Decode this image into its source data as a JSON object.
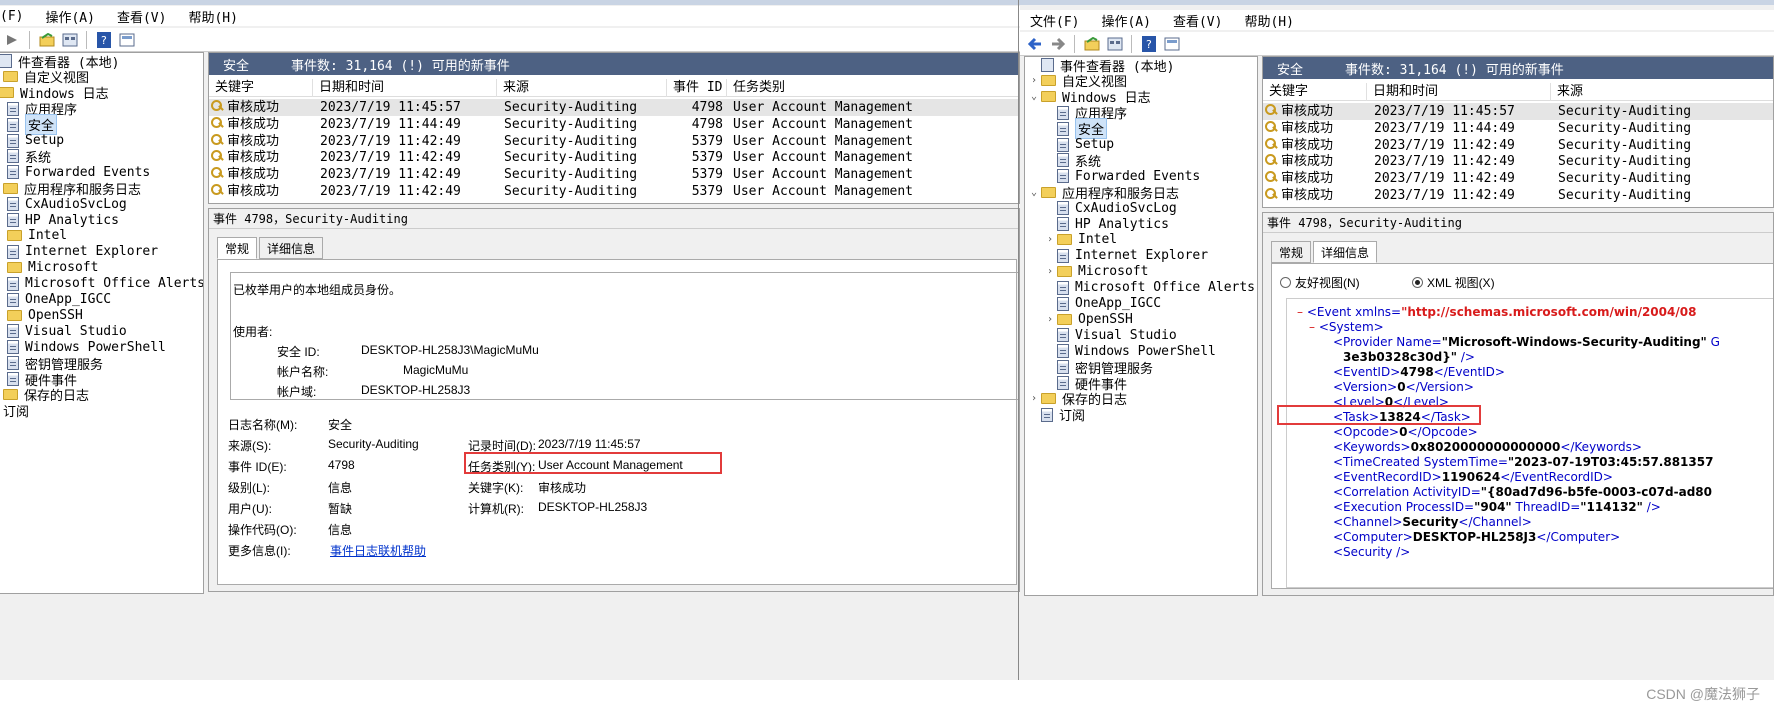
{
  "left": {
    "menu": [
      "(F)",
      "操作(A)",
      "查看(V)",
      "帮助(H)"
    ],
    "tree": [
      {
        "label": "件查看器 (本地)",
        "icon": "root",
        "selected": false
      },
      {
        "label": "自定义视图",
        "icon": "folder",
        "selected": false
      },
      {
        "label": "Windows 日志",
        "icon": "folder",
        "selected": false
      },
      {
        "label": "应用程序",
        "icon": "log",
        "selected": false
      },
      {
        "label": "安全",
        "icon": "log",
        "selected": true
      },
      {
        "label": "Setup",
        "icon": "log",
        "selected": false
      },
      {
        "label": "系统",
        "icon": "log",
        "selected": false
      },
      {
        "label": "Forwarded Events",
        "icon": "log",
        "selected": false
      },
      {
        "label": "应用程序和服务日志",
        "icon": "folder",
        "selected": false
      },
      {
        "label": "CxAudioSvcLog",
        "icon": "log",
        "selected": false
      },
      {
        "label": "HP Analytics",
        "icon": "log",
        "selected": false
      },
      {
        "label": "Intel",
        "icon": "folder",
        "selected": false
      },
      {
        "label": "Internet Explorer",
        "icon": "log",
        "selected": false
      },
      {
        "label": "Microsoft",
        "icon": "folder",
        "selected": false
      },
      {
        "label": "Microsoft Office Alerts",
        "icon": "log",
        "selected": false
      },
      {
        "label": "OneApp_IGCC",
        "icon": "log",
        "selected": false
      },
      {
        "label": "OpenSSH",
        "icon": "folder",
        "selected": false
      },
      {
        "label": "Visual Studio",
        "icon": "log",
        "selected": false
      },
      {
        "label": "Windows PowerShell",
        "icon": "log",
        "selected": false
      },
      {
        "label": "密钥管理服务",
        "icon": "log",
        "selected": false
      },
      {
        "label": "硬件事件",
        "icon": "log",
        "selected": false
      },
      {
        "label": "保存的日志",
        "icon": "folder",
        "selected": false
      },
      {
        "label": "订阅",
        "icon": "none",
        "selected": false
      }
    ],
    "header": {
      "name": "安全",
      "count": "事件数: 31,164 (!) 可用的新事件"
    },
    "columns": [
      "关键字",
      "日期和时间",
      "来源",
      "事件 ID",
      "任务类别"
    ],
    "rows": [
      [
        "审核成功",
        "2023/7/19 11:45:57",
        "Security-Auditing",
        "4798",
        "User Account Management"
      ],
      [
        "审核成功",
        "2023/7/19 11:44:49",
        "Security-Auditing",
        "4798",
        "User Account Management"
      ],
      [
        "审核成功",
        "2023/7/19 11:42:49",
        "Security-Auditing",
        "5379",
        "User Account Management"
      ],
      [
        "审核成功",
        "2023/7/19 11:42:49",
        "Security-Auditing",
        "5379",
        "User Account Management"
      ],
      [
        "审核成功",
        "2023/7/19 11:42:49",
        "Security-Auditing",
        "5379",
        "User Account Management"
      ],
      [
        "审核成功",
        "2023/7/19 11:42:49",
        "Security-Auditing",
        "5379",
        "User Account Management"
      ]
    ],
    "detail": {
      "title": "事件 4798，Security-Auditing",
      "tabs": [
        "常规",
        "详细信息"
      ],
      "description": "已枚举用户的本地组成员身份。",
      "user_label": "使用者:",
      "sid_label": "安全 ID:",
      "sid_value": "DESKTOP-HL258J3\\MagicMuMu",
      "acct_label": "帐户名称:",
      "acct_value": "MagicMuMu",
      "domain_label": "帐户域:",
      "domain_value": "DESKTOP-HL258J3",
      "log_name_label": "日志名称(M):",
      "log_name": "安全",
      "source_label": "来源(S):",
      "source": "Security-Auditing",
      "logged_label": "记录时间(D):",
      "logged": "2023/7/19 11:45:57",
      "event_id_label": "事件 ID(E):",
      "event_id": "4798",
      "task_label": "任务类别(Y):",
      "task": "User Account Management",
      "level_label": "级别(L):",
      "level": "信息",
      "keywords_label": "关键字(K):",
      "keywords": "审核成功",
      "user2_label": "用户(U):",
      "user2": "暂缺",
      "computer_label": "计算机(R):",
      "computer": "DESKTOP-HL258J3",
      "opcode_label": "操作代码(O):",
      "opcode": "信息",
      "more_label": "更多信息(I):",
      "more_link": "事件日志联机帮助"
    }
  },
  "right": {
    "menu": [
      "文件(F)",
      "操作(A)",
      "查看(V)",
      "帮助(H)"
    ],
    "tree": [
      {
        "label": "事件查看器 (本地)",
        "icon": "root",
        "arrow": ""
      },
      {
        "label": "自定义视图",
        "icon": "folder",
        "arrow": "›"
      },
      {
        "label": "Windows 日志",
        "icon": "folder",
        "arrow": "⌄"
      },
      {
        "label": "应用程序",
        "icon": "log",
        "arrow": ""
      },
      {
        "label": "安全",
        "icon": "log",
        "arrow": "",
        "selected": true
      },
      {
        "label": "Setup",
        "icon": "log",
        "arrow": ""
      },
      {
        "label": "系统",
        "icon": "log",
        "arrow": ""
      },
      {
        "label": "Forwarded Events",
        "icon": "log",
        "arrow": ""
      },
      {
        "label": "应用程序和服务日志",
        "icon": "folder",
        "arrow": "⌄"
      },
      {
        "label": "CxAudioSvcLog",
        "icon": "log",
        "arrow": ""
      },
      {
        "label": "HP Analytics",
        "icon": "log",
        "arrow": ""
      },
      {
        "label": "Intel",
        "icon": "folder",
        "arrow": "›"
      },
      {
        "label": "Internet Explorer",
        "icon": "log",
        "arrow": ""
      },
      {
        "label": "Microsoft",
        "icon": "folder",
        "arrow": "›"
      },
      {
        "label": "Microsoft Office Alerts",
        "icon": "log",
        "arrow": ""
      },
      {
        "label": "OneApp_IGCC",
        "icon": "log",
        "arrow": ""
      },
      {
        "label": "OpenSSH",
        "icon": "folder",
        "arrow": "›"
      },
      {
        "label": "Visual Studio",
        "icon": "log",
        "arrow": ""
      },
      {
        "label": "Windows PowerShell",
        "icon": "log",
        "arrow": ""
      },
      {
        "label": "密钥管理服务",
        "icon": "log",
        "arrow": ""
      },
      {
        "label": "硬件事件",
        "icon": "log",
        "arrow": ""
      },
      {
        "label": "保存的日志",
        "icon": "folder",
        "arrow": "›"
      },
      {
        "label": "订阅",
        "icon": "log",
        "arrow": ""
      }
    ],
    "header": {
      "name": "安全",
      "count": "事件数: 31,164 (!) 可用的新事件"
    },
    "columns": [
      "关键字",
      "日期和时间",
      "来源"
    ],
    "rows": [
      [
        "审核成功",
        "2023/7/19 11:45:57",
        "Security-Auditing"
      ],
      [
        "审核成功",
        "2023/7/19 11:44:49",
        "Security-Auditing"
      ],
      [
        "审核成功",
        "2023/7/19 11:42:49",
        "Security-Auditing"
      ],
      [
        "审核成功",
        "2023/7/19 11:42:49",
        "Security-Auditing"
      ],
      [
        "审核成功",
        "2023/7/19 11:42:49",
        "Security-Auditing"
      ],
      [
        "审核成功",
        "2023/7/19 11:42:49",
        "Security-Auditing"
      ]
    ],
    "detail": {
      "title": "事件 4798，Security-Auditing",
      "tabs": [
        "常规",
        "详细信息"
      ],
      "radio_friendly": "友好视图(N)",
      "radio_xml": "XML 视图(X)"
    },
    "xml": {
      "event_open": "<Event xmlns=",
      "event_ns": "\"http://schemas.microsoft.com/win/2004/08",
      "system_open": "<System>",
      "provider_open": "<Provider Name=",
      "provider_name": "\"Microsoft-Windows-Security-Auditing\"",
      "provider_tail": " G",
      "provider_line2": "3e3b0328c30d}\"",
      "provider_close": " />",
      "eventid_open": "<EventID>",
      "eventid": "4798",
      "eventid_close": "</EventID>",
      "version_open": "<Version>",
      "version": "0",
      "version_close": "</Version>",
      "level_open": "<Level>",
      "level": "0",
      "level_close": "</Level>",
      "task_open": "<Task>",
      "task": "13824",
      "task_close": "</Task>",
      "opcode_open": "<Opcode>",
      "opcode": "0",
      "opcode_close": "</Opcode>",
      "keywords_open": "<Keywords>",
      "keywords": "0x8020000000000000",
      "keywords_close": "</Keywords>",
      "time_open": "<TimeCreated SystemTime=",
      "time": "\"2023-07-19T03:45:57.881357",
      "record_open": "<EventRecordID>",
      "record": "1190624",
      "record_close": "</EventRecordID>",
      "corr_open": "<Correlation ActivityID=",
      "corr": "\"{80ad7d96-b5fe-0003-c07d-ad80",
      "exec_open": "<Execution ProcessID=",
      "exec_pid": "\"904\"",
      "exec_mid": " ThreadID=",
      "exec_tid": "\"114132\"",
      "exec_close": " />",
      "channel_open": "<Channel>",
      "channel": "Security",
      "channel_close": "</Channel>",
      "computer_open": "<Computer>",
      "computer": "DESKTOP-HL258J3",
      "computer_close": "</Computer>",
      "security": "<Security />"
    }
  },
  "watermark": "CSDN @魔法狮子",
  "colors": {
    "header_bar": "#4d6183",
    "highlight": "#e23b3b",
    "xml_tag": "#0000c8",
    "xml_attr": "#d81b1b"
  }
}
